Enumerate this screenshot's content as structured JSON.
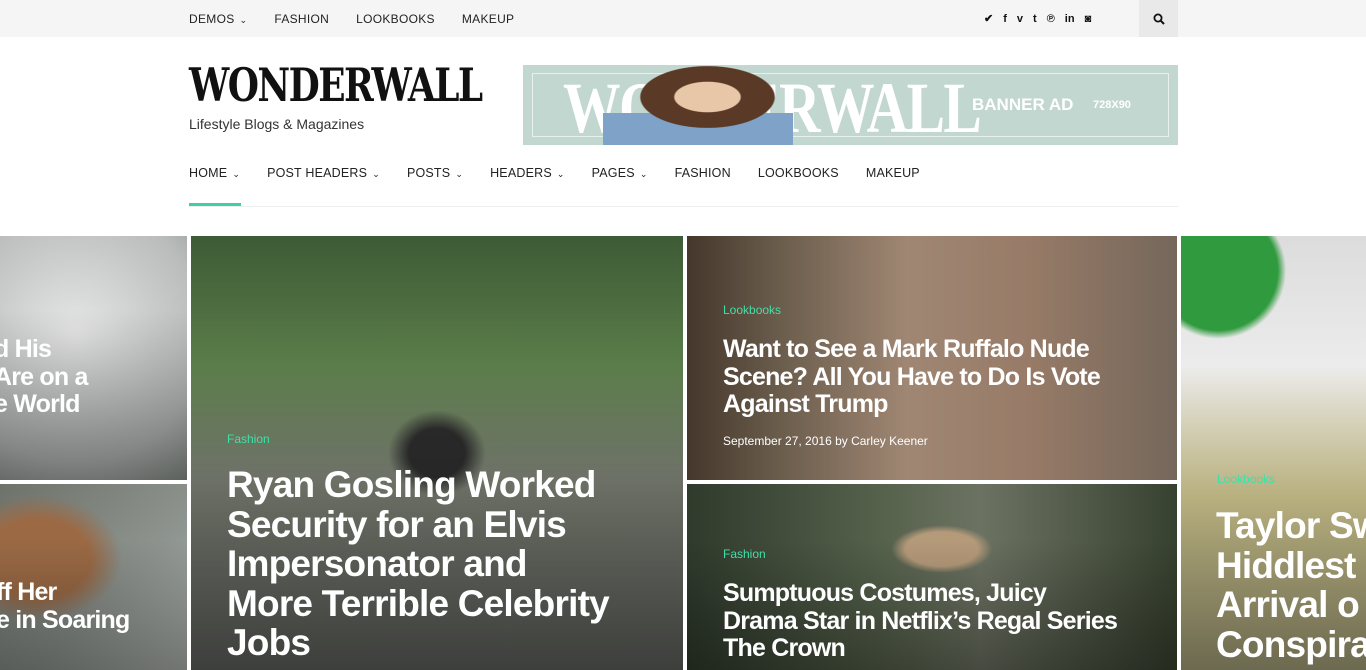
{
  "topbar": {
    "menu": [
      {
        "label": "DEMOS",
        "dropdown": true
      },
      {
        "label": "FASHION"
      },
      {
        "label": "LOOKBOOKS"
      },
      {
        "label": "MAKEUP"
      }
    ],
    "social": [
      "twitter-icon",
      "facebook-icon",
      "vimeo-icon",
      "tumblr-icon",
      "pinterest-icon",
      "linkedin-icon",
      "instagram-icon"
    ],
    "social_glyphs": [
      "🐦",
      "f",
      "v",
      "t",
      "℗",
      "in",
      "◙"
    ],
    "search_icon": "search-icon"
  },
  "header": {
    "logo": "WONDERWALL",
    "tagline": "Lifestyle Blogs & Magazines",
    "banner": {
      "logo_text": "WONDERWALL",
      "label": "BANNER AD",
      "size": "728X90",
      "bg": "#c1d7cf"
    }
  },
  "nav": {
    "items": [
      {
        "label": "HOME",
        "dropdown": true,
        "active": true
      },
      {
        "label": "POST HEADERS",
        "dropdown": true
      },
      {
        "label": "POSTS",
        "dropdown": true
      },
      {
        "label": "HEADERS",
        "dropdown": true
      },
      {
        "label": "PAGES",
        "dropdown": true
      },
      {
        "label": "FASHION"
      },
      {
        "label": "LOOKBOOKS"
      },
      {
        "label": "MAKEUP"
      }
    ],
    "accent": "#3bd1a4"
  },
  "posts": [
    {
      "title_l1": "d His",
      "title_l2": "Are on a",
      "title_l3": "e World"
    },
    {
      "title_l1": "ff Her",
      "title_l2": "e in Soaring"
    },
    {
      "category": "Fashion",
      "title_l1": "Ryan Gosling Worked",
      "title_l2": "Security for an Elvis",
      "title_l3": "Impersonator and",
      "title_l4": "More Terrible Celebrity",
      "title_l5": "Jobs"
    },
    {
      "category": "Lookbooks",
      "title_l1": "Want to See a Mark Ruffalo Nude",
      "title_l2": "Scene? All You Have to Do Is Vote",
      "title_l3": "Against Trump",
      "meta": "September 27, 2016 by Carley Keener"
    },
    {
      "category": "Fashion",
      "title_l1": "Sumptuous Costumes, Juicy",
      "title_l2": "Drama Star in Netflix’s Regal Series",
      "title_l3": "The Crown"
    },
    {
      "category": "Lookbooks",
      "title_l1": "Taylor Sw",
      "title_l2": "Hiddlest",
      "title_l3": "Arrival o",
      "title_l4": "Conspira"
    }
  ]
}
